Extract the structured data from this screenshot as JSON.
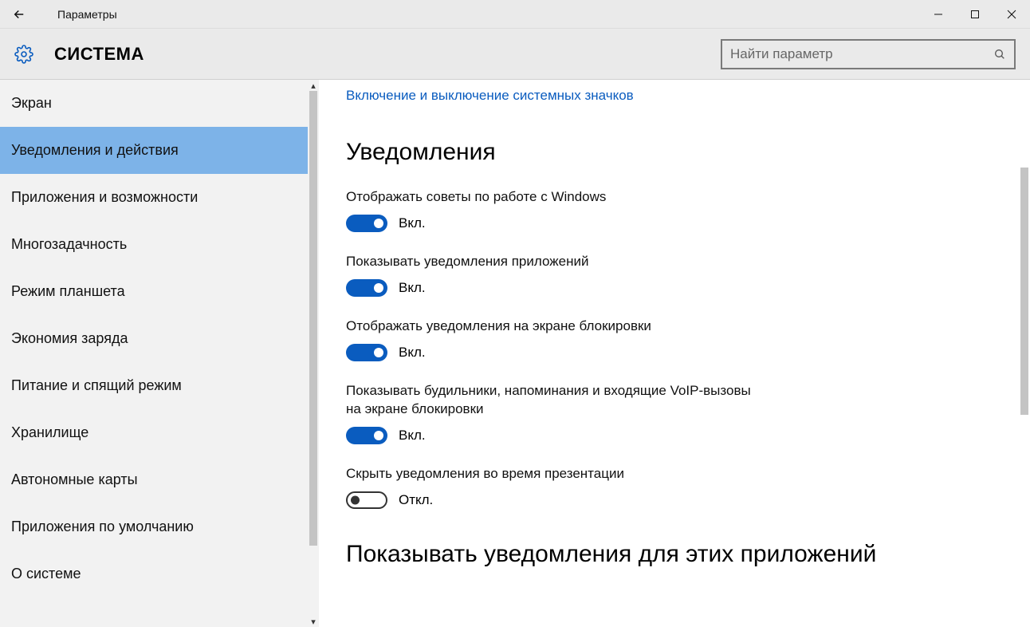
{
  "window": {
    "title": "Параметры"
  },
  "header": {
    "title": "СИСТЕМА",
    "search_placeholder": "Найти параметр"
  },
  "sidebar": {
    "items": [
      {
        "label": "Экран",
        "selected": false
      },
      {
        "label": "Уведомления и действия",
        "selected": true
      },
      {
        "label": "Приложения и возможности",
        "selected": false
      },
      {
        "label": "Многозадачность",
        "selected": false
      },
      {
        "label": "Режим планшета",
        "selected": false
      },
      {
        "label": "Экономия заряда",
        "selected": false
      },
      {
        "label": "Питание и спящий режим",
        "selected": false
      },
      {
        "label": "Хранилище",
        "selected": false
      },
      {
        "label": "Автономные карты",
        "selected": false
      },
      {
        "label": "Приложения по умолчанию",
        "selected": false
      },
      {
        "label": "О системе",
        "selected": false
      }
    ]
  },
  "content": {
    "top_link": "Включение и выключение системных значков",
    "section1_heading": "Уведомления",
    "toggle_on_label": "Вкл.",
    "toggle_off_label": "Откл.",
    "settings": [
      {
        "label": "Отображать советы по работе с Windows",
        "on": true
      },
      {
        "label": "Показывать уведомления приложений",
        "on": true
      },
      {
        "label": "Отображать уведомления на экране блокировки",
        "on": true
      },
      {
        "label": "Показывать будильники, напоминания и входящие VoIP-вызовы на экране блокировки",
        "on": true
      },
      {
        "label": "Скрыть уведомления во время презентации",
        "on": false
      }
    ],
    "section2_heading": "Показывать уведомления для этих приложений"
  }
}
